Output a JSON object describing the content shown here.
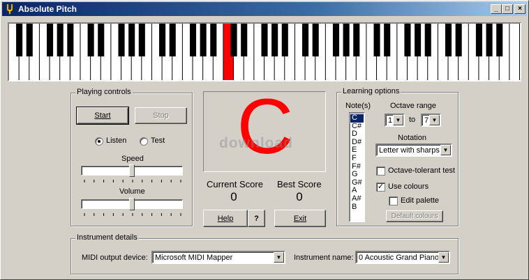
{
  "window": {
    "title": "Absolute Pitch",
    "min": "_",
    "max": "□",
    "close": "×"
  },
  "piano": {
    "white_keys": 50,
    "highlighted_white_key": 21
  },
  "playing": {
    "title": "Playing controls",
    "start": "Start",
    "stop": "Stop",
    "listen": "Listen",
    "test": "Test",
    "mode": "Listen",
    "speed_label": "Speed",
    "speed_value": 0.5,
    "volume_label": "Volume",
    "volume_value": 0.5
  },
  "display": {
    "note": "C",
    "note_color": "#ff0000",
    "watermark": "download",
    "current_score_label": "Current Score",
    "current_score": "0",
    "best_score_label": "Best Score",
    "best_score": "0",
    "help": "Help",
    "question": "?",
    "exit": "Exit"
  },
  "learning": {
    "title": "Learning options",
    "notes_label": "Note(s)",
    "notes": [
      "C",
      "C#",
      "D",
      "D#",
      "E",
      "F",
      "F#",
      "G",
      "G#",
      "A",
      "A#",
      "B"
    ],
    "selected_note": "C",
    "octave_label": "Octave range",
    "octave_from": "1",
    "octave_to_label": "to",
    "octave_to": "7",
    "notation_label": "Notation",
    "notation": "Letter with sharps",
    "octave_tolerant": "Octave-tolerant test",
    "octave_tolerant_checked": false,
    "use_colours": "Use colours",
    "use_colours_checked": true,
    "edit_palette": "Edit palette",
    "edit_palette_checked": false,
    "default_colours": "Default colours"
  },
  "instrument": {
    "title": "Instrument details",
    "midi_label": "MIDI output device:",
    "midi_value": "Microsoft MIDI Mapper",
    "name_label": "Instrument name:",
    "name_value": "0 Acoustic Grand Piano"
  }
}
